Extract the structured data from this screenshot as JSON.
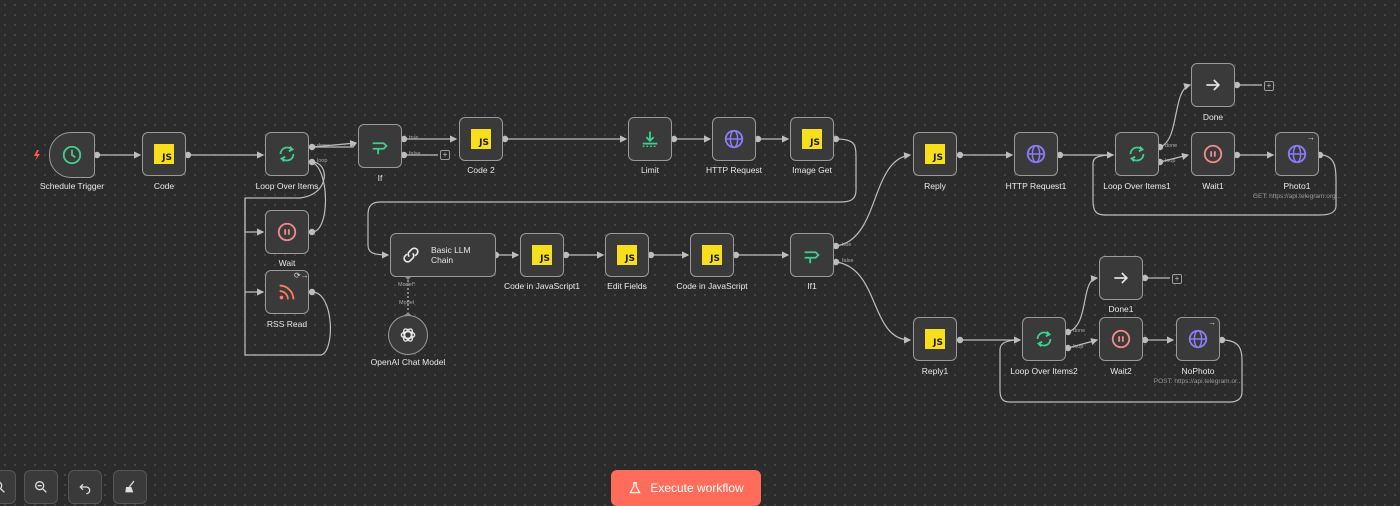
{
  "nodes": {
    "schedule_trigger": {
      "label": "Schedule Trigger",
      "icon": "clock-icon"
    },
    "code": {
      "label": "Code",
      "icon": "js-icon",
      "icon_text": "JS"
    },
    "loop_over_items": {
      "label": "Loop Over Items",
      "icon": "loop-icon",
      "port_done": "done",
      "port_loop": "loop"
    },
    "wait": {
      "label": "Wait",
      "icon": "pause-icon"
    },
    "rss_read": {
      "label": "RSS Read",
      "icon": "rss-icon"
    },
    "if": {
      "label": "If",
      "icon": "if-icon",
      "port_true": "true",
      "port_false": "false"
    },
    "code2": {
      "label": "Code 2",
      "icon": "js-icon",
      "icon_text": "JS"
    },
    "limit": {
      "label": "Limit",
      "icon": "limit-icon"
    },
    "http_request": {
      "label": "HTTP Request",
      "icon": "globe-icon"
    },
    "image_get": {
      "label": "Image Get",
      "icon": "js-icon",
      "icon_text": "JS"
    },
    "basic_llm_chain": {
      "label": "Basic LLM Chain",
      "icon": "chain-link-icon",
      "port_model": "Model*"
    },
    "openai_chat_model": {
      "label": "OpenAI Chat Model",
      "icon": "openai-icon",
      "port_model": "Model"
    },
    "code_in_js1": {
      "label": "Code in JavaScript1",
      "icon": "js-icon",
      "icon_text": "JS"
    },
    "edit_fields": {
      "label": "Edit Fields",
      "icon": "js-icon",
      "icon_text": "JS"
    },
    "code_in_js": {
      "label": "Code in JavaScript",
      "icon": "js-icon",
      "icon_text": "JS"
    },
    "if1": {
      "label": "If1",
      "icon": "if-icon",
      "port_true": "true",
      "port_false": "false"
    },
    "reply": {
      "label": "Reply",
      "icon": "js-icon",
      "icon_text": "JS"
    },
    "http_request1": {
      "label": "HTTP Request1",
      "icon": "globe-icon"
    },
    "loop_over_items1": {
      "label": "Loop Over Items1",
      "icon": "loop-icon",
      "port_done": "done",
      "port_loop": "loop"
    },
    "done": {
      "label": "Done",
      "icon": "arrow-right-icon"
    },
    "wait1": {
      "label": "Wait1",
      "icon": "pause-icon"
    },
    "photo1": {
      "label": "Photo1",
      "icon": "globe-icon",
      "subtitle": "GET: https://api.telegram.org..."
    },
    "reply1": {
      "label": "Reply1",
      "icon": "js-icon",
      "icon_text": "JS"
    },
    "loop_over_items2": {
      "label": "Loop Over Items2",
      "icon": "loop-icon",
      "port_done": "done",
      "port_loop": "loop"
    },
    "done1": {
      "label": "Done1",
      "icon": "arrow-right-icon"
    },
    "wait2": {
      "label": "Wait2",
      "icon": "pause-icon"
    },
    "nophoto": {
      "label": "NoPhoto",
      "icon": "globe-icon",
      "subtitle": "POST: https://api.telegram.or..."
    }
  },
  "toolbar": {
    "execute_label": "Execute workflow",
    "execute_icon": "flask-icon",
    "buttons": [
      "zoom-in-icon",
      "zoom-out-icon",
      "undo-icon",
      "tidy-up-icon"
    ]
  },
  "colors": {
    "accent": "#ff6d5a",
    "js_yellow": "#f7df1e",
    "loop_green": "#3ecf8e",
    "globe_purple": "#8a7cf6",
    "pause_red": "#f08a8a",
    "rss_orange": "#ff7b5c",
    "canvas": "#2b2b2b"
  }
}
